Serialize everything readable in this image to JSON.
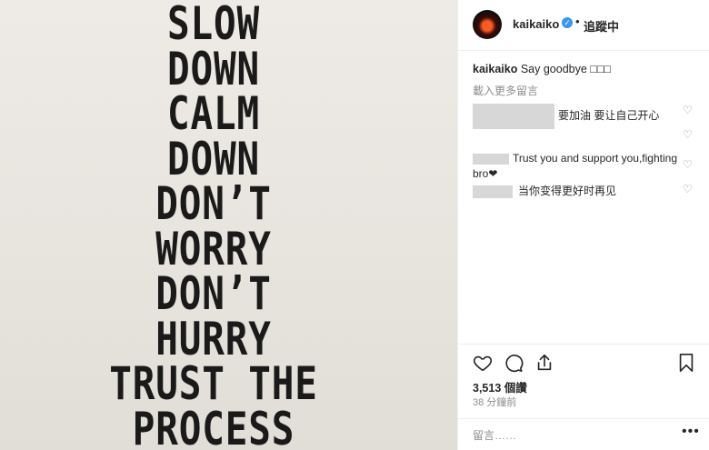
{
  "poster": {
    "lines": [
      "SLOW",
      "DOWN",
      "CALM",
      "DOWN",
      "DON’T",
      "WORRY",
      "DON’T",
      "HURRY",
      "TRUST THE",
      "PROCESS"
    ]
  },
  "header": {
    "username": "kaikaiko",
    "separator": "•",
    "follow_label": "追蹤中"
  },
  "caption": {
    "username": "kaikaiko",
    "text": "Say goodbye □□□"
  },
  "load_more": "載入更多留言",
  "comments": [
    {
      "text": "要加油 要让自己开心"
    },
    {
      "text": "Trust you and support you,fighting bro❤"
    },
    {
      "text": "当你变得更好时再见"
    }
  ],
  "likes": "3,513 個讚",
  "time_ago": "38 分鐘前",
  "add_comment_placeholder": "留言……",
  "add_comment_more": "•••",
  "icons": {
    "heart": "heart-icon",
    "comment": "comment-icon",
    "share": "share-icon",
    "bookmark": "bookmark-icon"
  }
}
